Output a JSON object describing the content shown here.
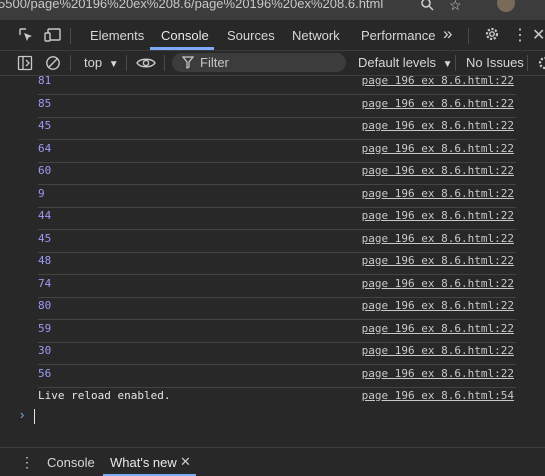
{
  "browser": {
    "url_fragment": "5500/page%20196%20ex%208.6/page%20196%20ex%208.6.html"
  },
  "devtools": {
    "tabs": [
      "Elements",
      "Console",
      "Sources",
      "Network",
      "Performance"
    ],
    "more_tabs_symbol": "»",
    "active_tab": "Console"
  },
  "toolbar": {
    "context": "top",
    "filter_placeholder": "Filter",
    "levels": "Default levels",
    "issues": "No Issues"
  },
  "console": {
    "entries": [
      {
        "value": "81",
        "source": "page 196 ex 8.6.html:22"
      },
      {
        "value": "85",
        "source": "page 196 ex 8.6.html:22"
      },
      {
        "value": "45",
        "source": "page 196 ex 8.6.html:22"
      },
      {
        "value": "64",
        "source": "page 196 ex 8.6.html:22"
      },
      {
        "value": "60",
        "source": "page 196 ex 8.6.html:22"
      },
      {
        "value": "9",
        "source": "page 196 ex 8.6.html:22"
      },
      {
        "value": "44",
        "source": "page 196 ex 8.6.html:22"
      },
      {
        "value": "45",
        "source": "page 196 ex 8.6.html:22"
      },
      {
        "value": "48",
        "source": "page 196 ex 8.6.html:22"
      },
      {
        "value": "74",
        "source": "page 196 ex 8.6.html:22"
      },
      {
        "value": "80",
        "source": "page 196 ex 8.6.html:22"
      },
      {
        "value": "59",
        "source": "page 196 ex 8.6.html:22"
      },
      {
        "value": "30",
        "source": "page 196 ex 8.6.html:22"
      },
      {
        "value": "56",
        "source": "page 196 ex 8.6.html:22"
      }
    ],
    "message": {
      "text": "Live reload enabled.",
      "source": "page 196 ex 8.6.html:54"
    }
  },
  "drawer": {
    "tabs": [
      "Console",
      "What's new"
    ],
    "active": "What's new"
  },
  "colors": {
    "accent": "#7cacf8",
    "number": "#9d9af7",
    "background": "#282828"
  }
}
